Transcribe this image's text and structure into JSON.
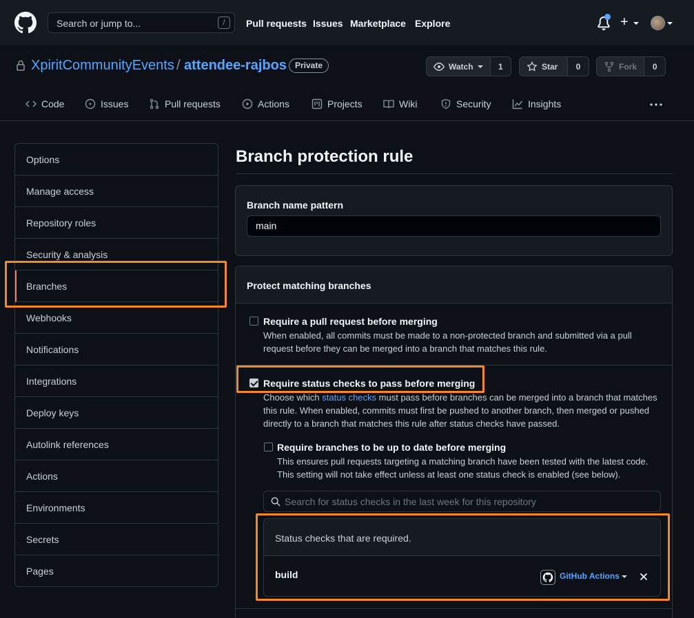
{
  "header": {
    "search_placeholder": "Search or jump to...",
    "search_key": "/",
    "nav": [
      "Pull requests",
      "Issues",
      "Marketplace",
      "Explore"
    ]
  },
  "repo": {
    "owner": "XpiritCommunityEvents",
    "separator": "/",
    "name": "attendee-rajbos",
    "visibility": "Private",
    "watch_label": "Watch",
    "watch_count": "1",
    "star_label": "Star",
    "star_count": "0",
    "fork_label": "Fork",
    "fork_count": "0",
    "tabs": [
      "Code",
      "Issues",
      "Pull requests",
      "Actions",
      "Projects",
      "Wiki",
      "Security",
      "Insights"
    ]
  },
  "sidebar": {
    "items": [
      "Options",
      "Manage access",
      "Repository roles",
      "Security & analysis",
      "Branches",
      "Webhooks",
      "Notifications",
      "Integrations",
      "Deploy keys",
      "Autolink references",
      "Actions",
      "Environments",
      "Secrets",
      "Pages"
    ],
    "selected": "Branches"
  },
  "main": {
    "title": "Branch protection rule",
    "pattern_label": "Branch name pattern",
    "pattern_value": "main",
    "protect_heading": "Protect matching branches",
    "opt1": {
      "title": "Require a pull request before merging",
      "desc1": "When enabled, all commits must be made to a non-protected branch and submitted via a pull",
      "desc2": "request before they can be merged into a branch that matches this rule.",
      "checked": false
    },
    "opt2": {
      "title": "Require status checks to pass before merging",
      "desc1_pre": "Choose which ",
      "desc1_link": "status checks",
      "desc1_post": " must pass before branches can be merged into a branch that matches",
      "desc2": "this rule. When enabled, commits must first be pushed to another branch, then merged or pushed",
      "desc3": "directly to a branch that matches this rule after status checks have passed.",
      "checked": true
    },
    "opt2a": {
      "title": "Require branches to be up to date before merging",
      "desc1": "This ensures pull requests targeting a matching branch have been tested with the latest code.",
      "desc2": "This setting will not take effect unless at least one status check is enabled (see below).",
      "checked": false
    },
    "status_search_placeholder": "Search for status checks in the last week for this repository",
    "required_heading": "Status checks that are required.",
    "check_name": "build",
    "check_app": "GitHub Actions"
  },
  "colors": {
    "highlight": "#f6891f",
    "link": "#58a6ff",
    "background": "#0d1117"
  }
}
